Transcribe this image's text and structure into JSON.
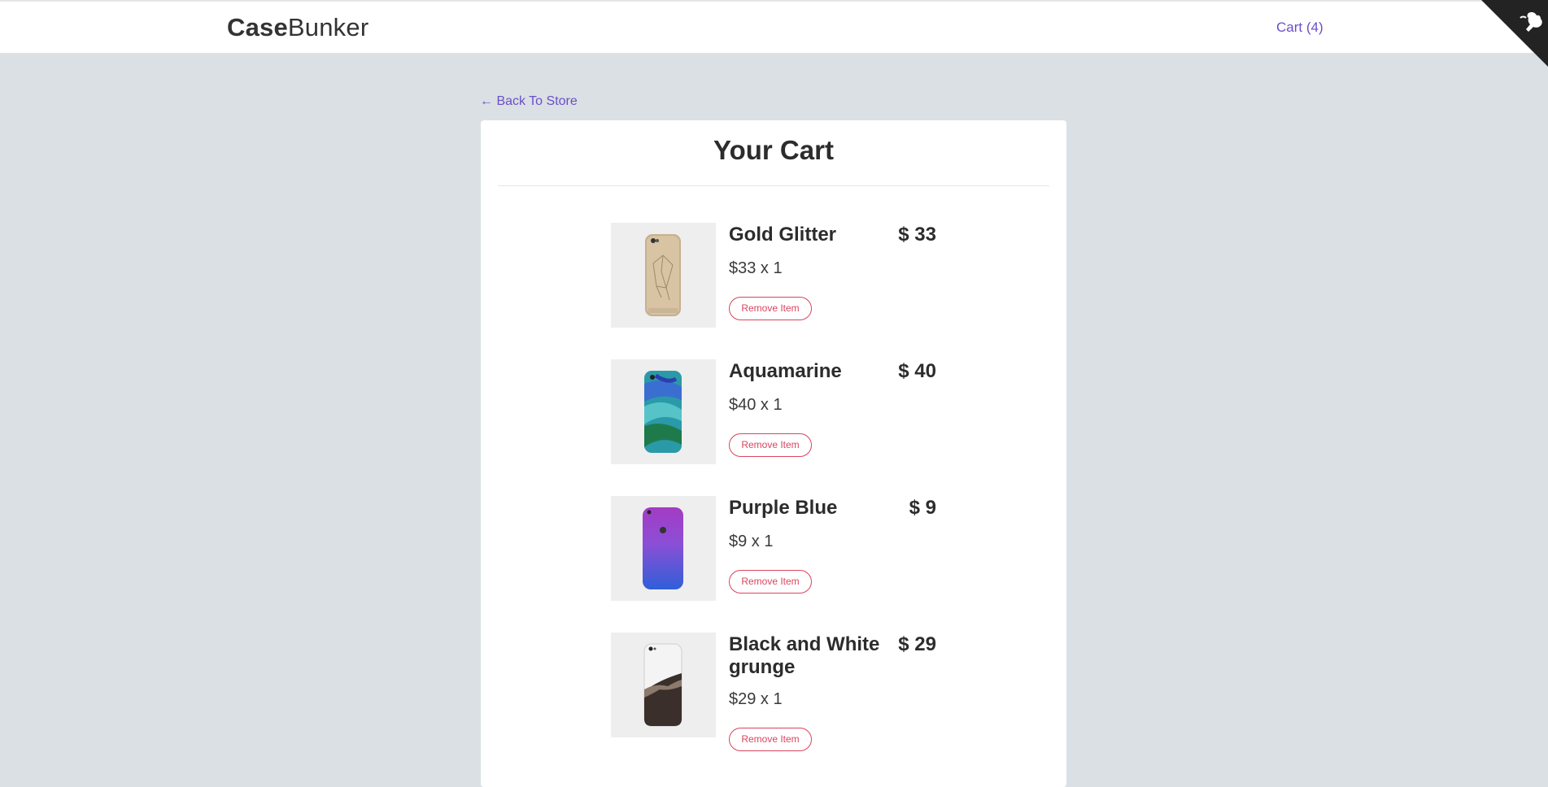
{
  "header": {
    "brand_bold": "Case",
    "brand_light": "Bunker",
    "cart_label": "Cart (4)"
  },
  "nav": {
    "back_label": "← Back To Store"
  },
  "cart": {
    "title": "Your Cart",
    "items": [
      {
        "name": "Gold Glitter",
        "price": "$ 33",
        "qty_line": "$33 x 1",
        "remove_label": "Remove Item"
      },
      {
        "name": "Aquamarine",
        "price": "$ 40",
        "qty_line": "$40 x 1",
        "remove_label": "Remove Item"
      },
      {
        "name": "Purple Blue",
        "price": "$ 9",
        "qty_line": "$9 x 1",
        "remove_label": "Remove Item"
      },
      {
        "name": "Black and White grunge",
        "price": "$ 29",
        "qty_line": "$29 x 1",
        "remove_label": "Remove Item"
      }
    ]
  },
  "colors": {
    "accent": "#6a4fc9",
    "danger": "#d9455f",
    "background": "#dae0e3"
  },
  "icons": {
    "corner": "github-octocat-icon",
    "back": "arrow-left-icon"
  }
}
